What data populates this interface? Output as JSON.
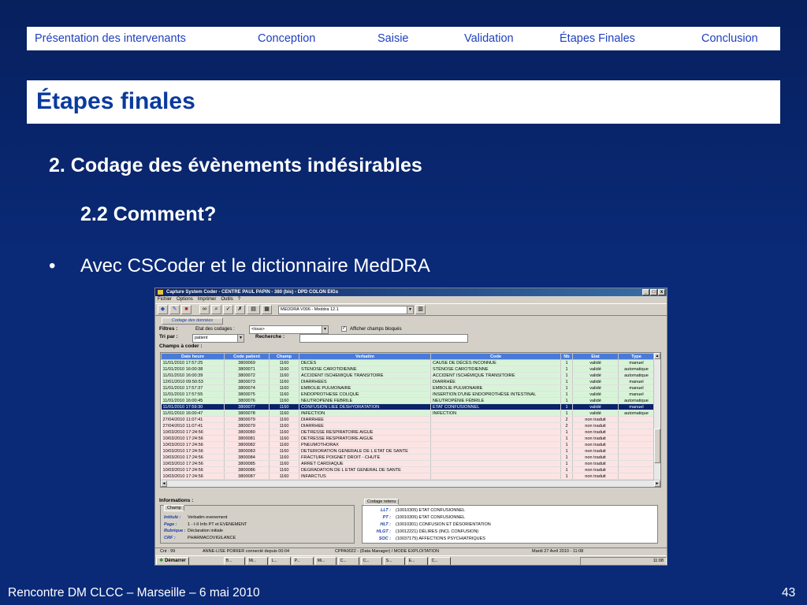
{
  "nav": [
    "Présentation des intervenants",
    "Conception",
    "Saisie",
    "Validation",
    "Étapes Finales",
    "Conclusion"
  ],
  "title": "Étapes finales",
  "heading1": "2. Codage des évènements indésirables",
  "heading2": "2.2 Comment?",
  "bullet_char": "•",
  "bullet": "Avec CSCoder et le dictionnaire MedDRA",
  "footer_left": "Rencontre DM CLCC – Marseille – 6 mai 2010",
  "page_number": "43",
  "window": {
    "title": "Capture System Coder - CENTRE PAUL PAPIN - 380 (bis) - DPD COLON EIGs",
    "controls": [
      "_",
      "□",
      "x"
    ],
    "menu": [
      "Fichier",
      "Options",
      "Imprimer",
      "Outils",
      "?"
    ],
    "dictionary": "MEDDRA V006 - Meddra 12.1",
    "coding_tab": "Codage des données",
    "filters_label": "Filtres :",
    "state_label": "Etat des codages :",
    "state_value": "<tous>",
    "show_locked": "Afficher champs bloqués",
    "sort_label": "Tri par :",
    "sort_value": "patient",
    "search_label": "Recherche :",
    "search_value": "",
    "fields_label": "Champs à coder :",
    "columns": [
      "Date heure",
      "Code patient",
      "Champ",
      "Verbatim",
      "Code",
      "Nb",
      "Etat",
      "Type"
    ],
    "rows": [
      [
        "11/01/2010 17:57:25",
        "3800069",
        "1160",
        "DECES",
        "CAUSE DE DÉCÈS INCONNUE",
        "1",
        "validé",
        "manuel"
      ],
      [
        "11/01/2010 16:00:38",
        "3800071",
        "1160",
        "STENOSE CAROTIDIENNE",
        "STÉNOSE CAROTIDIENNE",
        "1",
        "validé",
        "automatique"
      ],
      [
        "11/01/2010 16:00:39",
        "3800072",
        "1160",
        "ACCIDENT ISCHEMIQUE TRANSITOIRE",
        "ACCIDENT ISCHÉMIQUE TRANSITOIRE",
        "1",
        "validé",
        "automatique"
      ],
      [
        "12/01/2010 09:50:53",
        "3800073",
        "1160",
        "DIARRHEES",
        "DIARRHÉE",
        "1",
        "validé",
        "manuel"
      ],
      [
        "11/01/2010 17:57:37",
        "3800074",
        "1160",
        "EMBOLIE PULMONAIRE",
        "EMBOLIE PULMONAIRE",
        "1",
        "validé",
        "manuel"
      ],
      [
        "11/01/2010 17:57:55",
        "3800075",
        "1160",
        "ENDOPROTHESE COLIQUE",
        "INSERTION D'UNE ENDOPROTHÈSE INTESTINAL",
        "1",
        "validé",
        "manuel"
      ],
      [
        "11/01/2010 16:00:45",
        "3800076",
        "1160",
        "NEUTROPENIE FEBRILE",
        "NEUTROPÉNIE FÉBRILE",
        "1",
        "validé",
        "automatique"
      ],
      [
        "11/01/2010 17:59:30",
        "3800077",
        "1160",
        "CONFUSION LIEE DESHYDRATATION",
        "ETAT CONFUSIONNEL",
        "1",
        "validé",
        "manuel"
      ],
      [
        "11/01/2010 16:00:47",
        "3800078",
        "1160",
        "INFECTION",
        "INFECTION",
        "1",
        "validé",
        "automatique"
      ],
      [
        "27/04/2010 11:07:41",
        "3800079",
        "1160",
        "DIARRHEE",
        "",
        "2",
        "non traduit",
        ""
      ],
      [
        "27/04/2010 11:07:41",
        "3800079",
        "1160",
        "DIARRHEE",
        "",
        "2",
        "non traduit",
        ""
      ],
      [
        "10/03/2010 17:24:56",
        "3800080",
        "1160",
        "DETRESSE RESPIRATOIRE AIGUE",
        "",
        "1",
        "non traduit",
        ""
      ],
      [
        "10/03/2010 17:24:56",
        "3800081",
        "1160",
        "DETRESSE RESPIRATOIRE AIGUE",
        "",
        "1",
        "non traduit",
        ""
      ],
      [
        "10/03/2010 17:24:56",
        "3800082",
        "1160",
        "PNEUMOTHORAX",
        "",
        "1",
        "non traduit",
        ""
      ],
      [
        "10/03/2010 17:24:56",
        "3800083",
        "1160",
        "DETERIORATION GENERALE DE L ETAT DE SANTE",
        "",
        "1",
        "non traduit",
        ""
      ],
      [
        "10/03/2010 17:24:56",
        "3800084",
        "1160",
        "FRACTURE POIGNET DROIT - CHUTE",
        "",
        "1",
        "non traduit",
        ""
      ],
      [
        "10/03/2010 17:24:56",
        "3800085",
        "1160",
        "ARRET CARDIAQUE",
        "",
        "1",
        "non traduit",
        ""
      ],
      [
        "10/03/2010 17:24:56",
        "3800086",
        "1160",
        "DEGRADATION DE L ETAT GENERAL DE SANTE",
        "",
        "1",
        "non traduit",
        ""
      ],
      [
        "10/03/2010 17:24:56",
        "3800087",
        "1160",
        "INFARCTUS",
        "",
        "1",
        "non traduit",
        ""
      ],
      [
        "10/03/2010 17:24:56",
        "3800088",
        "1160",
        "EXTRAVASATION DU PRODUIT DE CONTRASTE",
        "",
        "1",
        "non traduit",
        ""
      ]
    ],
    "selected_row": 7,
    "info_title": "Informations :",
    "info_tab": "Champ",
    "info": [
      {
        "k": "Intitulé :",
        "v": "Verbatim evenement"
      },
      {
        "k": "Page :",
        "v": "1 - I-II Info PT et EVENEMENT"
      },
      {
        "k": "Rubrique :",
        "v": "Déclaration initiale"
      },
      {
        "k": "CRF :",
        "v": "PHARMACOVIGILANCE"
      }
    ],
    "code_tab": "Codage retenu",
    "codes": [
      {
        "k": "LLT :",
        "v": "(10010305) ETAT CONFUSIONNEL"
      },
      {
        "k": "PT :",
        "v": "(10010305) ETAT CONFUSIONNEL"
      },
      {
        "k": "HLT :",
        "v": "(10010301) CONFUSION ET DÉSORIENTATION"
      },
      {
        "k": "HLGT :",
        "v": "(10012221) DÉLIRES (INCL CONFUSION)"
      },
      {
        "k": "SOC :",
        "v": "(10037175) AFFECTIONS PSYCHIATRIQUES"
      }
    ],
    "status": [
      "Cnt : 99",
      "ANNE-LISE POIRIER connecté depuis 00:04",
      "CPPA0022 - (Data Manager)  / MODE EXPLOITATION",
      "Mardi 27 Avril 2010  -  11:08"
    ],
    "start_label": "Démarrer",
    "tasks": [
      "B...",
      "Mi...",
      "L...",
      "P...",
      "Mi...",
      "C...",
      "C...",
      "S...",
      "E...",
      "C..."
    ],
    "clock": "11:08"
  }
}
